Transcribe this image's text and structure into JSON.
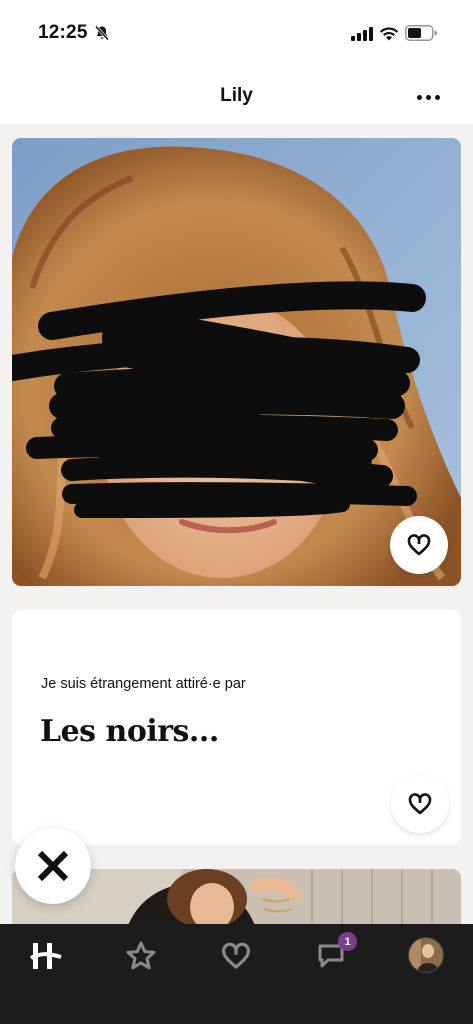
{
  "status_bar": {
    "time": "12:25"
  },
  "header": {
    "title": "Lily"
  },
  "prompt": {
    "question": "Je suis étrangement attiré·e par",
    "answer": "Les noirs..."
  },
  "nav": {
    "messages_badge": "1"
  },
  "colors": {
    "nav_background": "#1c1c1c",
    "badge": "#7a3e8c",
    "page_background": "#f3f2f1"
  },
  "icons": [
    "bell-off-icon",
    "signal-icon",
    "wifi-icon",
    "battery-icon",
    "more-icon",
    "heart-icon",
    "close-icon",
    "hinge-logo-icon",
    "star-icon",
    "heart-icon",
    "chat-icon"
  ]
}
